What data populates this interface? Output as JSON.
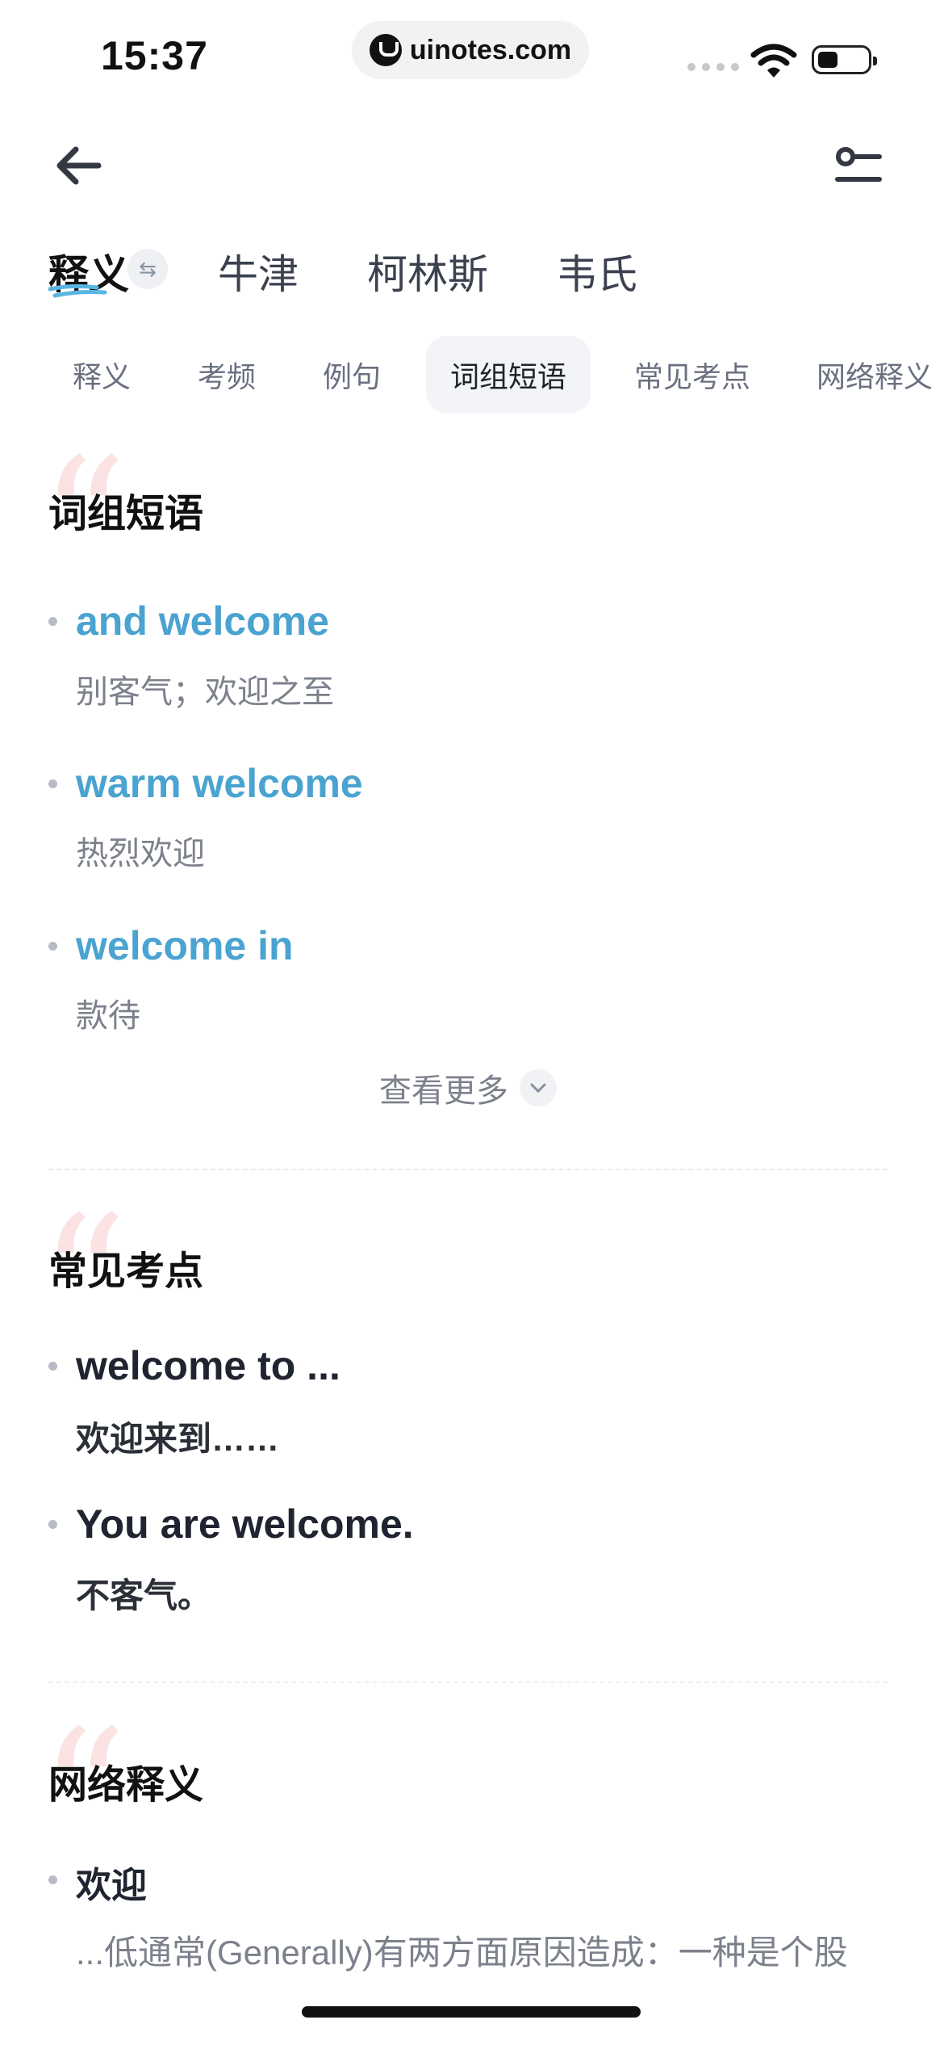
{
  "status_bar": {
    "time": "15:37",
    "url": "uinotes.com"
  },
  "dict_tabs": [
    "释义",
    "牛津",
    "柯林斯",
    "韦氏"
  ],
  "section_tabs": [
    "释义",
    "考频",
    "例句",
    "词组短语",
    "常见考点",
    "网络释义"
  ],
  "phrases": {
    "title": "词组短语",
    "items": [
      {
        "en": "and welcome",
        "cn": "别客气；欢迎之至"
      },
      {
        "en": "warm welcome",
        "cn": "热烈欢迎"
      },
      {
        "en": "welcome in",
        "cn": "款待"
      }
    ],
    "more_label": "查看更多"
  },
  "exam_points": {
    "title": "常见考点",
    "items": [
      {
        "en": "welcome to ...",
        "cn": "欢迎来到……"
      },
      {
        "en": "You are welcome.",
        "cn": "不客气。"
      }
    ]
  },
  "web_meanings": {
    "title": "网络释义",
    "word": "欢迎",
    "snippet": "...低通常(Generally)有两方面原因造成：一种是个股"
  },
  "colors": {
    "accent": "#4aa3d0",
    "quote_mark": "#fbe3e3",
    "active_tab_bg": "#f3f4f7"
  }
}
